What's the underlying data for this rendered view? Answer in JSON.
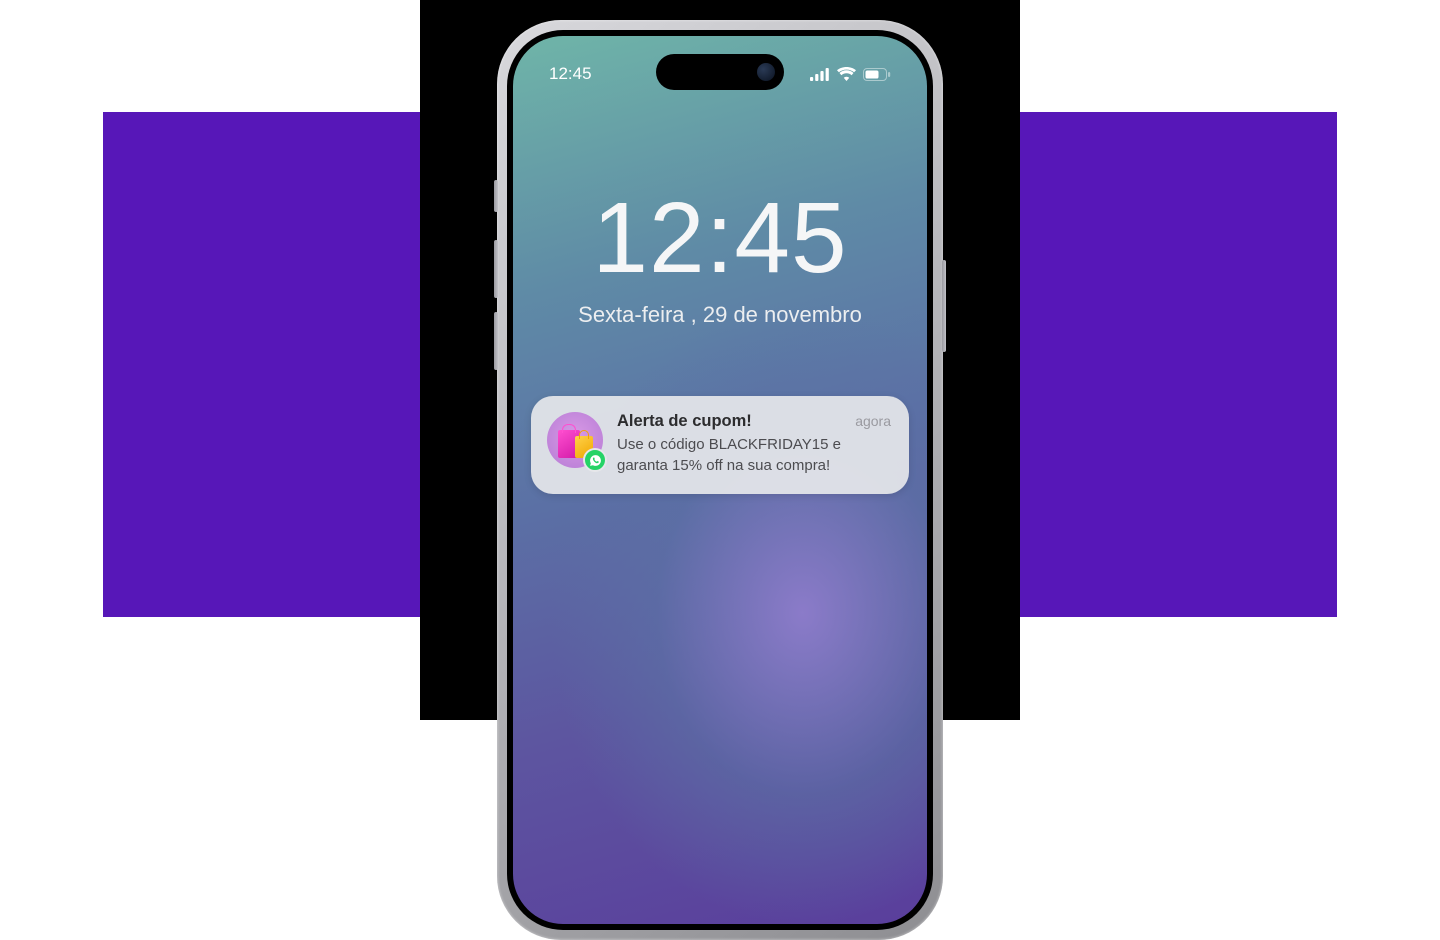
{
  "status": {
    "time": "12:45"
  },
  "lock": {
    "time": "12:45",
    "date": "Sexta-feira , 29 de novembro"
  },
  "notification": {
    "title": "Alerta de cupom!",
    "time": "agora",
    "message": "Use o código BLACKFRIDAY15 e garanta 15% off na sua compra!",
    "app_icon": "whatsapp-icon",
    "image_icon": "shopping-bags-icon"
  }
}
